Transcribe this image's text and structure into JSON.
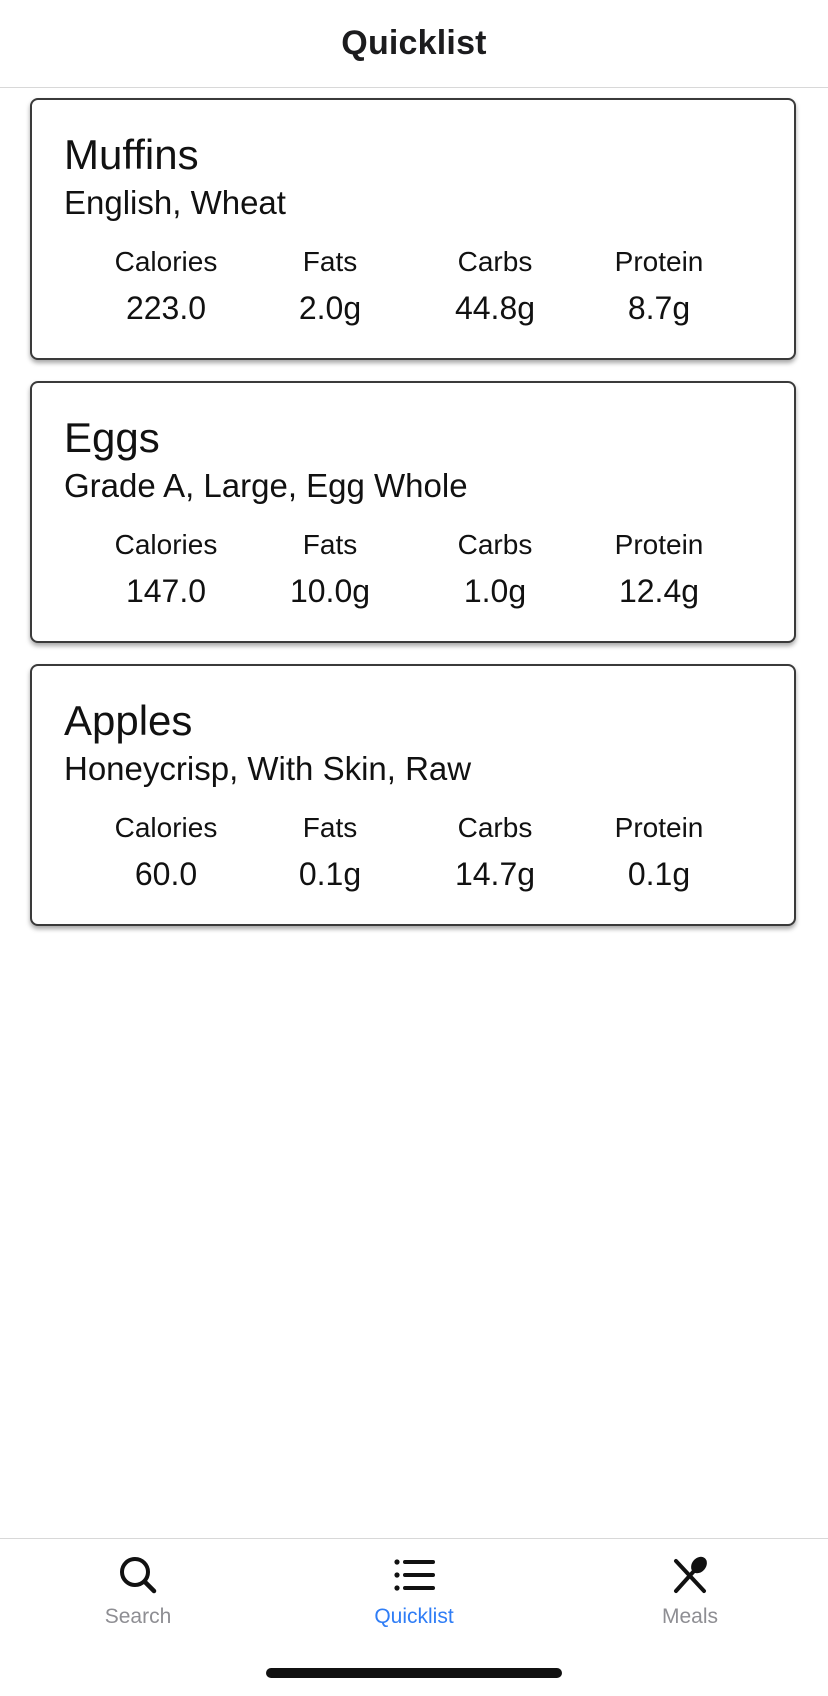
{
  "header": {
    "title": "Quicklist"
  },
  "stat_labels": {
    "calories": "Calories",
    "fats": "Fats",
    "carbs": "Carbs",
    "protein": "Protein"
  },
  "foods": [
    {
      "name": "Muffins",
      "description": "English, Wheat",
      "calories": "223.0",
      "fats": "2.0g",
      "carbs": "44.8g",
      "protein": "8.7g"
    },
    {
      "name": "Eggs",
      "description": "Grade A, Large, Egg Whole",
      "calories": "147.0",
      "fats": "10.0g",
      "carbs": "1.0g",
      "protein": "12.4g"
    },
    {
      "name": "Apples",
      "description": "Honeycrisp, With Skin, Raw",
      "calories": "60.0",
      "fats": "0.1g",
      "carbs": "14.7g",
      "protein": "0.1g"
    }
  ],
  "tabs": [
    {
      "label": "Search",
      "icon": "search-icon",
      "active": false
    },
    {
      "label": "Quicklist",
      "icon": "list-icon",
      "active": true
    },
    {
      "label": "Meals",
      "icon": "utensils-icon",
      "active": false
    }
  ],
  "colors": {
    "active_tab": "#2f7df6",
    "inactive_tab": "#8e8e93"
  }
}
